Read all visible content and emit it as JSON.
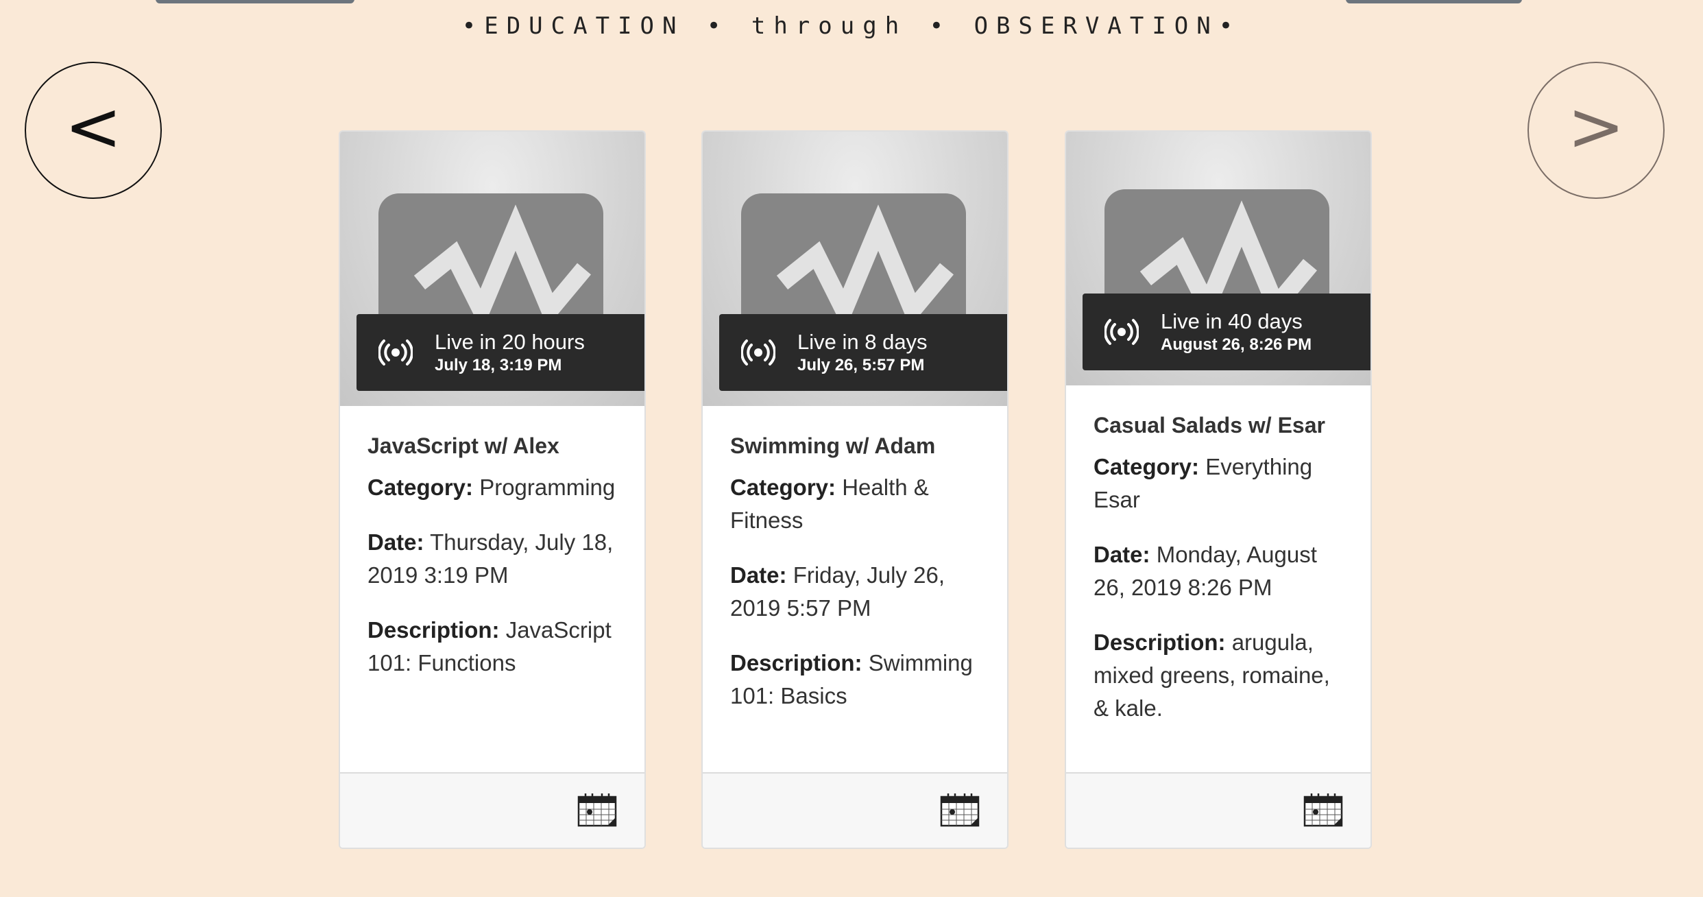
{
  "tagline": "•EDUCATION • through • OBSERVATION•",
  "nav": {
    "prev_label": "<",
    "next_label": ">"
  },
  "cards": [
    {
      "live_main": "Live in 20 hours",
      "live_sub": "July 18, 3:19 PM",
      "title": "JavaScript w/ Alex",
      "category_label": "Category:",
      "category": "Programming",
      "date_label": "Date:",
      "date": "Thursday, July 18, 2019 3:19 PM",
      "description_label": "Description:",
      "description": "JavaScript 101: Functions"
    },
    {
      "live_main": "Live in 8 days",
      "live_sub": "July 26, 5:57 PM",
      "title": "Swimming w/ Adam",
      "category_label": "Category:",
      "category": "Health & Fitness",
      "date_label": "Date:",
      "date": "Friday, July 26, 2019 5:57 PM",
      "description_label": "Description:",
      "description": "Swimming 101: Basics"
    },
    {
      "live_main": "Live in 40 days",
      "live_sub": "August 26, 8:26 PM",
      "title": "Casual Salads w/ Esar",
      "category_label": "Category:",
      "category": "Everything Esar",
      "date_label": "Date:",
      "date": "Monday, August 26, 2019 8:26 PM",
      "description_label": "Description:",
      "description": "arugula, mixed greens, romaine, & kale."
    }
  ],
  "icons": {
    "thumbnail": "live-tv-icon",
    "live": "broadcast-icon",
    "calendar": "calendar-icon"
  },
  "colors": {
    "background": "#fae9d7",
    "banner": "#2a2a2a",
    "card_footer": "#f7f7f7"
  }
}
